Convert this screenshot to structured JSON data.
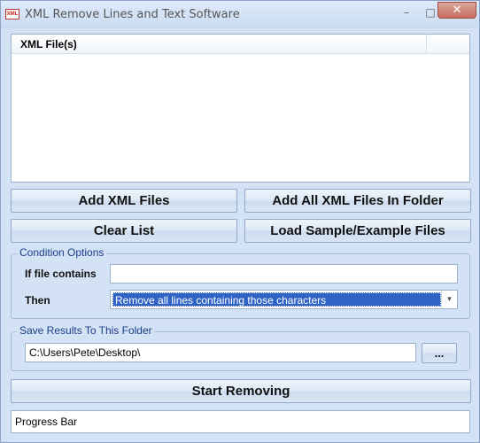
{
  "window": {
    "title": "XML Remove Lines and Text Software",
    "app_icon": "app-logo-icon",
    "icon_text": "XML",
    "minimize_glyph": "–",
    "maximize_glyph": "□",
    "close_glyph": "✕"
  },
  "file_list": {
    "column_header": "XML File(s)",
    "items": []
  },
  "buttons": {
    "add_files": "Add XML Files",
    "add_folder": "Add All XML Files In Folder",
    "clear_list": "Clear List",
    "load_sample": "Load Sample/Example Files",
    "start": "Start Removing",
    "browse": "..."
  },
  "condition": {
    "legend": "Condition Options",
    "if_label": "If file contains",
    "if_value": "",
    "then_label": "Then",
    "then_selected": "Remove all lines containing those characters"
  },
  "save": {
    "legend": "Save Results To This Folder",
    "path": "C:\\Users\\Pete\\Desktop\\"
  },
  "progress": {
    "label": "Progress Bar"
  },
  "colors": {
    "window_bg": "#d3e2f4",
    "selection": "#2f63c5",
    "legend_text": "#1a3f8a"
  }
}
